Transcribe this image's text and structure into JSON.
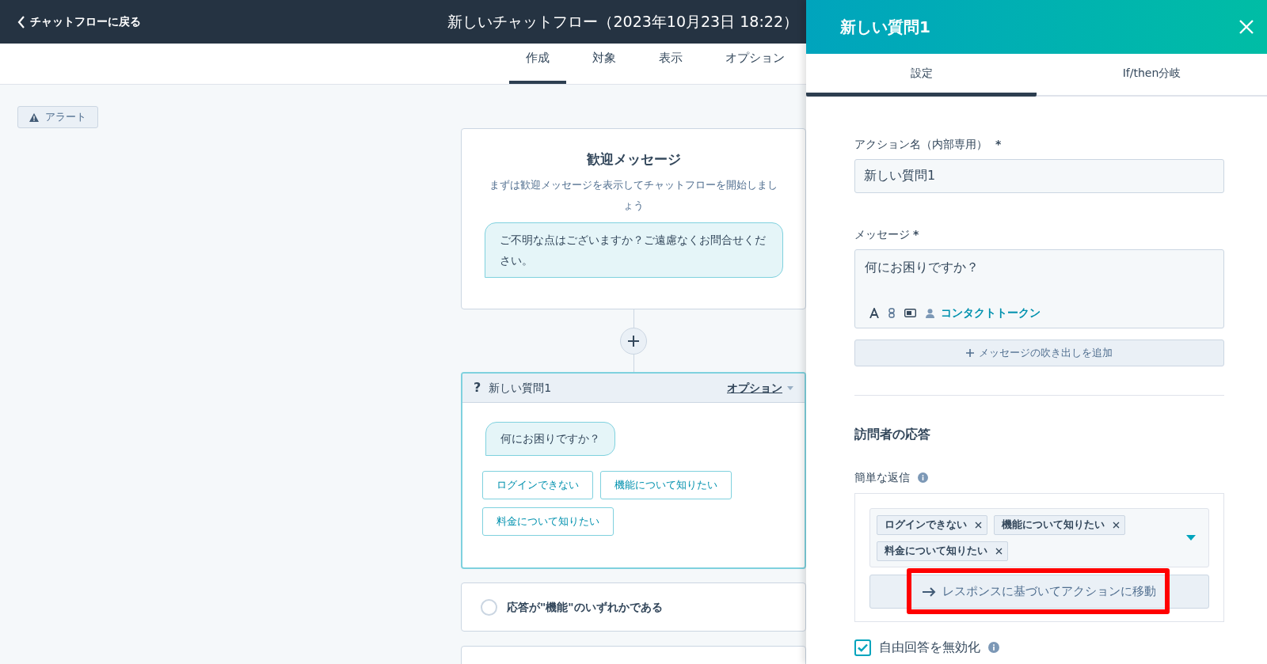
{
  "header": {
    "back_link": "チャットフローに戻る",
    "title": "新しいチャットフロー（2023年10月23日 18:22）"
  },
  "tabs": [
    {
      "label": "作成",
      "selected": true
    },
    {
      "label": "対象",
      "selected": false
    },
    {
      "label": "表示",
      "selected": false
    },
    {
      "label": "オプション",
      "selected": false
    }
  ],
  "alert_button": "アラート",
  "welcome_card": {
    "title": "歓迎メッセージ",
    "description": "まずは歓迎メッセージを表示してチャットフローを開始しましょう",
    "bubble": "ご不明な点はございますか？ご遠慮なくお問合せください。"
  },
  "question_card": {
    "icon": "?",
    "title": "新しい質問1",
    "options_link": "オプション",
    "bubble": "何にお困りですか？",
    "quick_replies": [
      "ログインできない",
      "機能について知りたい",
      "料金について知りたい"
    ]
  },
  "branch_card": {
    "label": "応答が\"機能\"のいずれかである",
    "selected": false
  },
  "panel": {
    "title": "新しい質問1",
    "tabs": [
      {
        "label": "設定",
        "selected": true
      },
      {
        "label": "If/then分岐",
        "selected": false
      }
    ],
    "action_name": {
      "label": "アクション名（内部専用）",
      "required_mark": "*",
      "value": "新しい質問1"
    },
    "message": {
      "label": "メッセージ",
      "required_mark": "*",
      "value": "何にお困りですか？",
      "contact_token": "コンタクトトークン"
    },
    "add_bubble_button": "メッセージの吹き出しを追加",
    "section_title": "訪問者の応答",
    "quick_replies": {
      "label": "簡単な返信",
      "tags": [
        "ログインできない",
        "機能について知りたい",
        "料金について知りたい"
      ],
      "goto_button": "レスポンスに基づいてアクションに移動",
      "highlighted": true
    },
    "disable_free_text": {
      "label": "自由回答を無効化",
      "checked": true
    }
  }
}
